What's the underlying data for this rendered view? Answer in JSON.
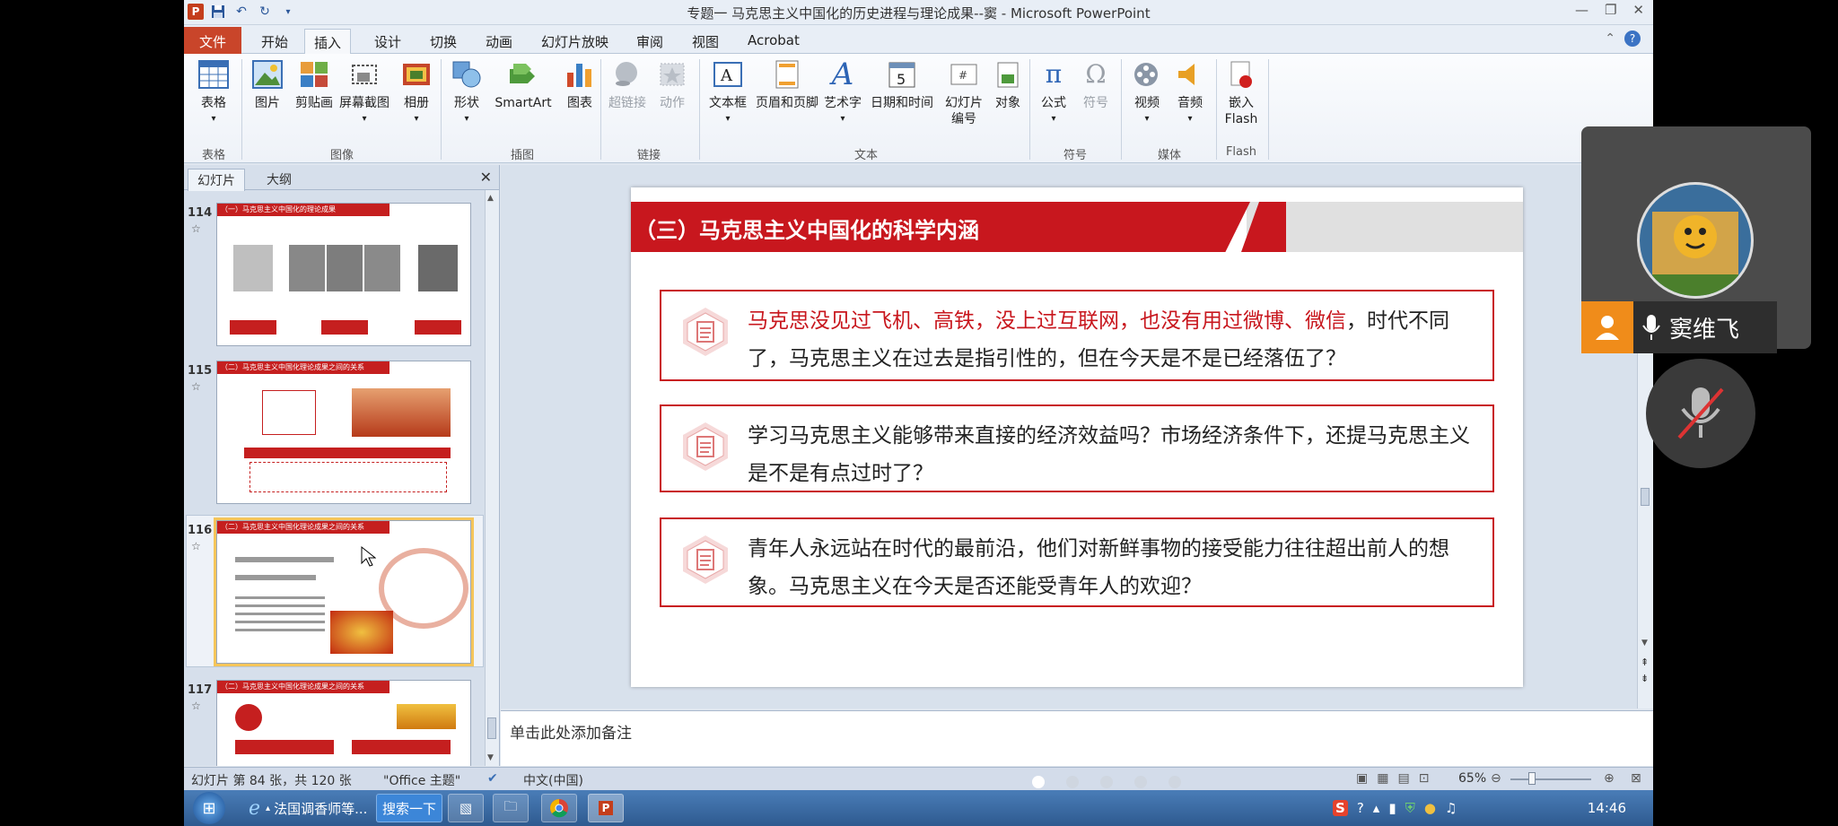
{
  "window": {
    "title": "专题一  马克思主义中国化的历史进程与理论成果--窦 - Microsoft PowerPoint"
  },
  "tabs": [
    "文件",
    "开始",
    "插入",
    "设计",
    "切换",
    "动画",
    "幻灯片放映",
    "审阅",
    "视图",
    "Acrobat"
  ],
  "active_tab": "插入",
  "ribbon": {
    "buttons": {
      "table": "表格",
      "picture": "图片",
      "clipart": "剪贴画",
      "screenshot": "屏幕截图",
      "album": "相册",
      "shape": "形状",
      "smartart": "SmartArt",
      "chart": "图表",
      "hyperlink": "超链接",
      "action": "动作",
      "textbox": "文本框",
      "header_footer": "页眉和页脚",
      "wordart": "艺术字",
      "datetime": "日期和时间",
      "slide_number_1": "幻灯片",
      "slide_number_2": "编号",
      "object": "对象",
      "equation": "公式",
      "symbol": "符号",
      "video": "视频",
      "audio": "音频",
      "flash_1": "嵌入",
      "flash_2": "Flash"
    },
    "groups": {
      "tables": "表格",
      "images": "图像",
      "illustrations": "插图",
      "links": "链接",
      "text": "文本",
      "symbols": "符号",
      "media": "媒体",
      "flash": "Flash"
    }
  },
  "left_pane": {
    "tabs": [
      "幻灯片",
      "大纲"
    ],
    "close_glyph": "✕",
    "thumbs": [
      {
        "num": "114",
        "title": "（一）马克思主义中国化的理论成果"
      },
      {
        "num": "115",
        "title": "（二）马克思主义中国化理论成果之间的关系"
      },
      {
        "num": "116",
        "title": "（二）马克思主义中国化理论成果之间的关系"
      },
      {
        "num": "117",
        "title": "（二）马克思主义中国化理论成果之间的关系"
      }
    ]
  },
  "slide": {
    "title": "（三）马克思主义中国化的科学内涵",
    "boxes": [
      {
        "red": "马克思没见过飞机、高铁，没上过互联网，也没有用过微博、微信",
        "rest": "，时代不同了，马克思主义在过去是指引性的，但在今天是不是已经落伍了？"
      },
      {
        "red": "",
        "rest": "学习马克思主义能够带来直接的经济效益吗？市场经济条件下，还提马克思主义是不是有点过时了？"
      },
      {
        "red": "",
        "rest": "青年人永远站在时代的最前沿，他们对新鲜事物的接受能力往往超出前人的想象。马克思主义在今天是否还能受青年人的欢迎？"
      }
    ]
  },
  "notes": {
    "placeholder": "单击此处添加备注"
  },
  "statusbar": {
    "slide_info": "幻灯片 第 84 张，共 120 张",
    "theme": "\"Office 主题\"",
    "language": "中文(中国)",
    "zoom": "65%"
  },
  "taskbar": {
    "items": [
      "法国调香师等...",
      "搜索一下"
    ],
    "clock": "14:46"
  },
  "meeting": {
    "participant_name": "窦维飞"
  },
  "colors": {
    "slide_red": "#c8171e",
    "file_tab": "#c9452a",
    "meeting_orange": "#f08c1a"
  }
}
